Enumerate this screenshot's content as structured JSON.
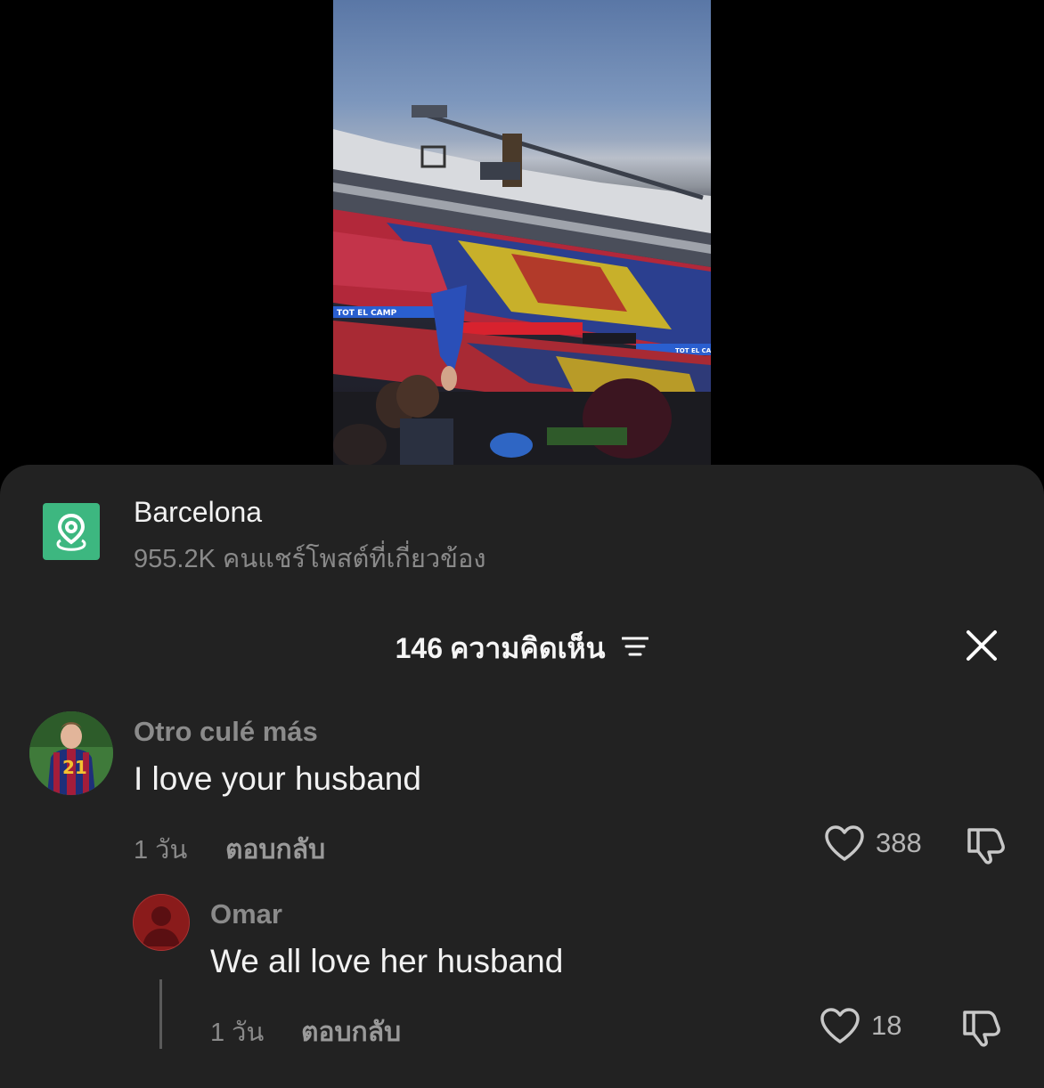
{
  "location": {
    "name": "Barcelona",
    "shares_count": "955.2K",
    "shares_label": "คนแชร์โพสต์ที่เกี่ยวข้อง",
    "icon": "map-pin-icon",
    "icon_bg": "#3db780"
  },
  "comments_header": {
    "count": "146",
    "label": "ความคิดเห็น"
  },
  "comments": [
    {
      "user": "Otro culé más",
      "text": "I love your husband",
      "time": "1 วัน",
      "reply_label": "ตอบกลับ",
      "likes": "388"
    },
    {
      "user": "Omar",
      "text": "We all love her husband",
      "time": "1 วัน",
      "reply_label": "ตอบกลับ",
      "likes": "18"
    }
  ],
  "video": {
    "banner_text_left": "TOT EL CAMP",
    "banner_text_right": "TOT EL CAMP"
  },
  "colors": {
    "sheet_bg": "#222222",
    "muted_text": "#8a8a8a",
    "primary_text": "#f2f2f2"
  }
}
